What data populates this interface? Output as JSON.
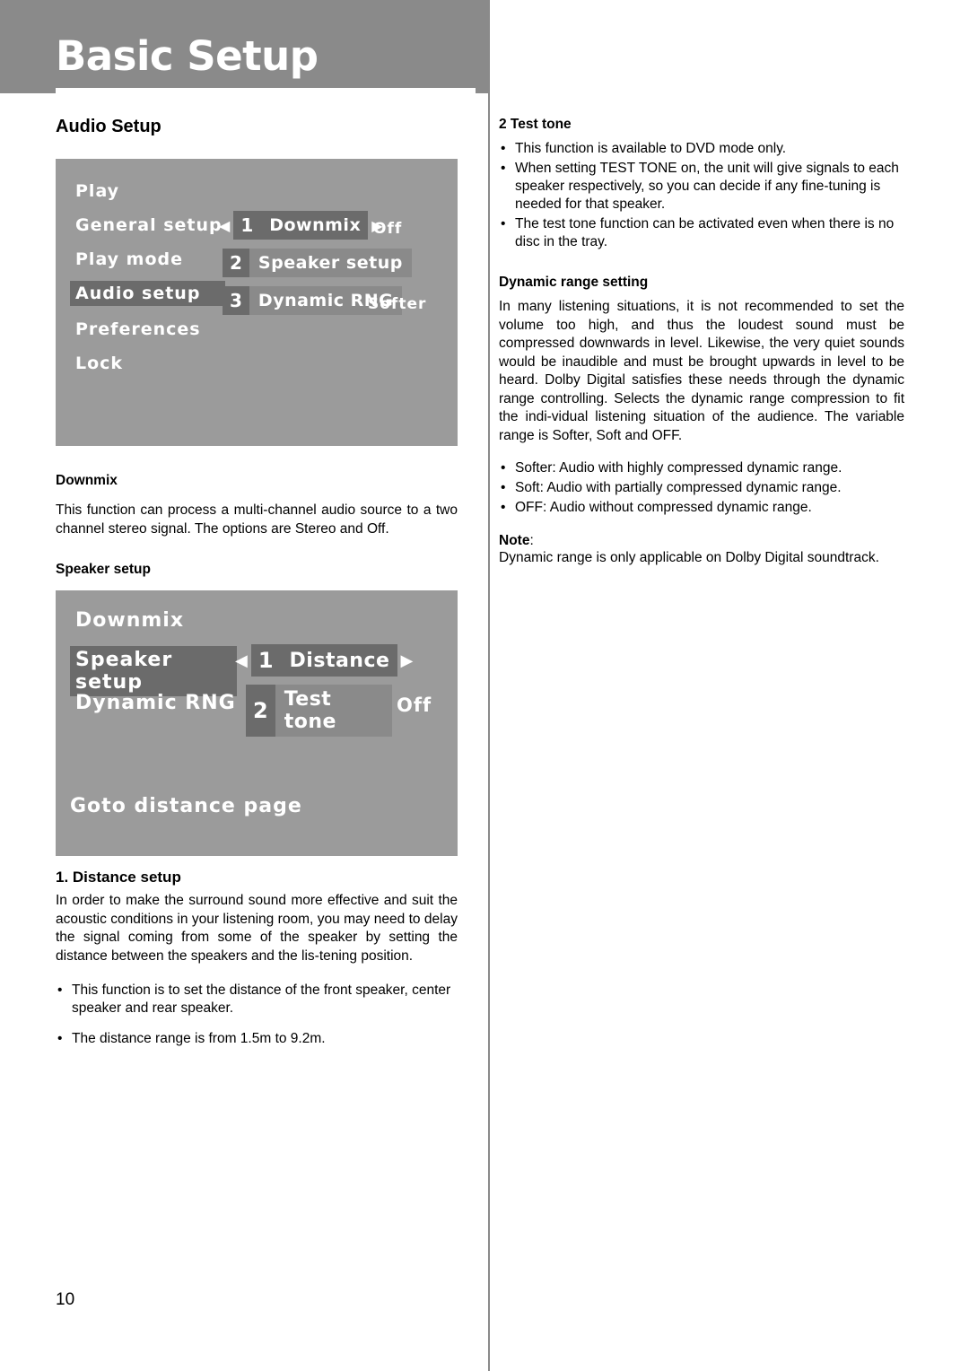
{
  "header": {
    "title": "Basic Setup"
  },
  "left": {
    "section_title": "Audio Setup",
    "osd1": {
      "menu": [
        {
          "label": "Play",
          "selected": false
        },
        {
          "label": "General setup",
          "selected": false
        },
        {
          "label": "Play mode",
          "selected": false
        },
        {
          "label": "Audio setup",
          "selected": true
        },
        {
          "label": "Preferences",
          "selected": false
        },
        {
          "label": "Lock",
          "selected": false
        }
      ],
      "rows": [
        {
          "num": "1",
          "label": "Downmix",
          "value": "Off",
          "left_arrow": "◀",
          "right_arrow": "▶"
        },
        {
          "num": "2",
          "label": "Speaker setup",
          "value": ""
        },
        {
          "num": "3",
          "label": "Dynamic RNG",
          "value": "Softer"
        }
      ]
    },
    "downmix_head": "Downmix",
    "downmix_text": "This function can process a multi-channel audio source to a two channel stereo signal. The options are Stereo and Off.",
    "speaker_head": "Speaker setup",
    "osd2": {
      "menu": [
        {
          "label": "Downmix",
          "selected": false
        },
        {
          "label": "Speaker setup",
          "selected": true
        },
        {
          "label": "Dynamic RNG",
          "selected": false
        }
      ],
      "rows": [
        {
          "num": "1",
          "label": "Distance",
          "value": "",
          "left_arrow": "◀",
          "right_arrow": "▶"
        },
        {
          "num": "2",
          "label": "Test tone",
          "value": "Off"
        }
      ],
      "footer": "Goto distance page"
    },
    "distance_head": "1. Distance setup",
    "distance_text": "In order to make the surround sound more effective and suit the acoustic conditions in your listening room, you may need to delay the signal coming from some of the speaker by setting the distance between the speakers and the lis-tening position.",
    "distance_bullets": [
      "This function is to set the distance of the front speaker, center speaker and rear speaker.",
      "The distance range is from 1.5m to 9.2m."
    ]
  },
  "right": {
    "test_tone_head": "2 Test tone",
    "test_tone_bullets": [
      "This function is available to DVD mode only.",
      "When setting TEST TONE on, the unit will give signals to each speaker respectively, so you can decide if any fine-tuning is needed for that speaker.",
      "The test tone function can be activated even when there is no disc in the tray."
    ],
    "dynamic_head": "Dynamic range setting",
    "dynamic_p1": "In many listening situations, it is not recommended to set the volume too high, and thus the loudest sound must be compressed downwards in level. Likewise, the very quiet sounds would be inaudible and must be brought upwards in level to be heard. Dolby Digital satisfies these needs through the dynamic range controlling. Selects the dynamic range compression to fit the indi-vidual listening situation of the audience. The variable range is Softer, Soft and OFF.",
    "dynamic_bullets": [
      "Softer: Audio with highly compressed dynamic range.",
      "Soft: Audio with partially compressed dynamic range.",
      "OFF: Audio without compressed dynamic range."
    ],
    "note_label": "Note",
    "note_colon": ":",
    "note_text": "Dynamic range is only applicable on Dolby Digital soundtrack."
  },
  "page_number": "10"
}
